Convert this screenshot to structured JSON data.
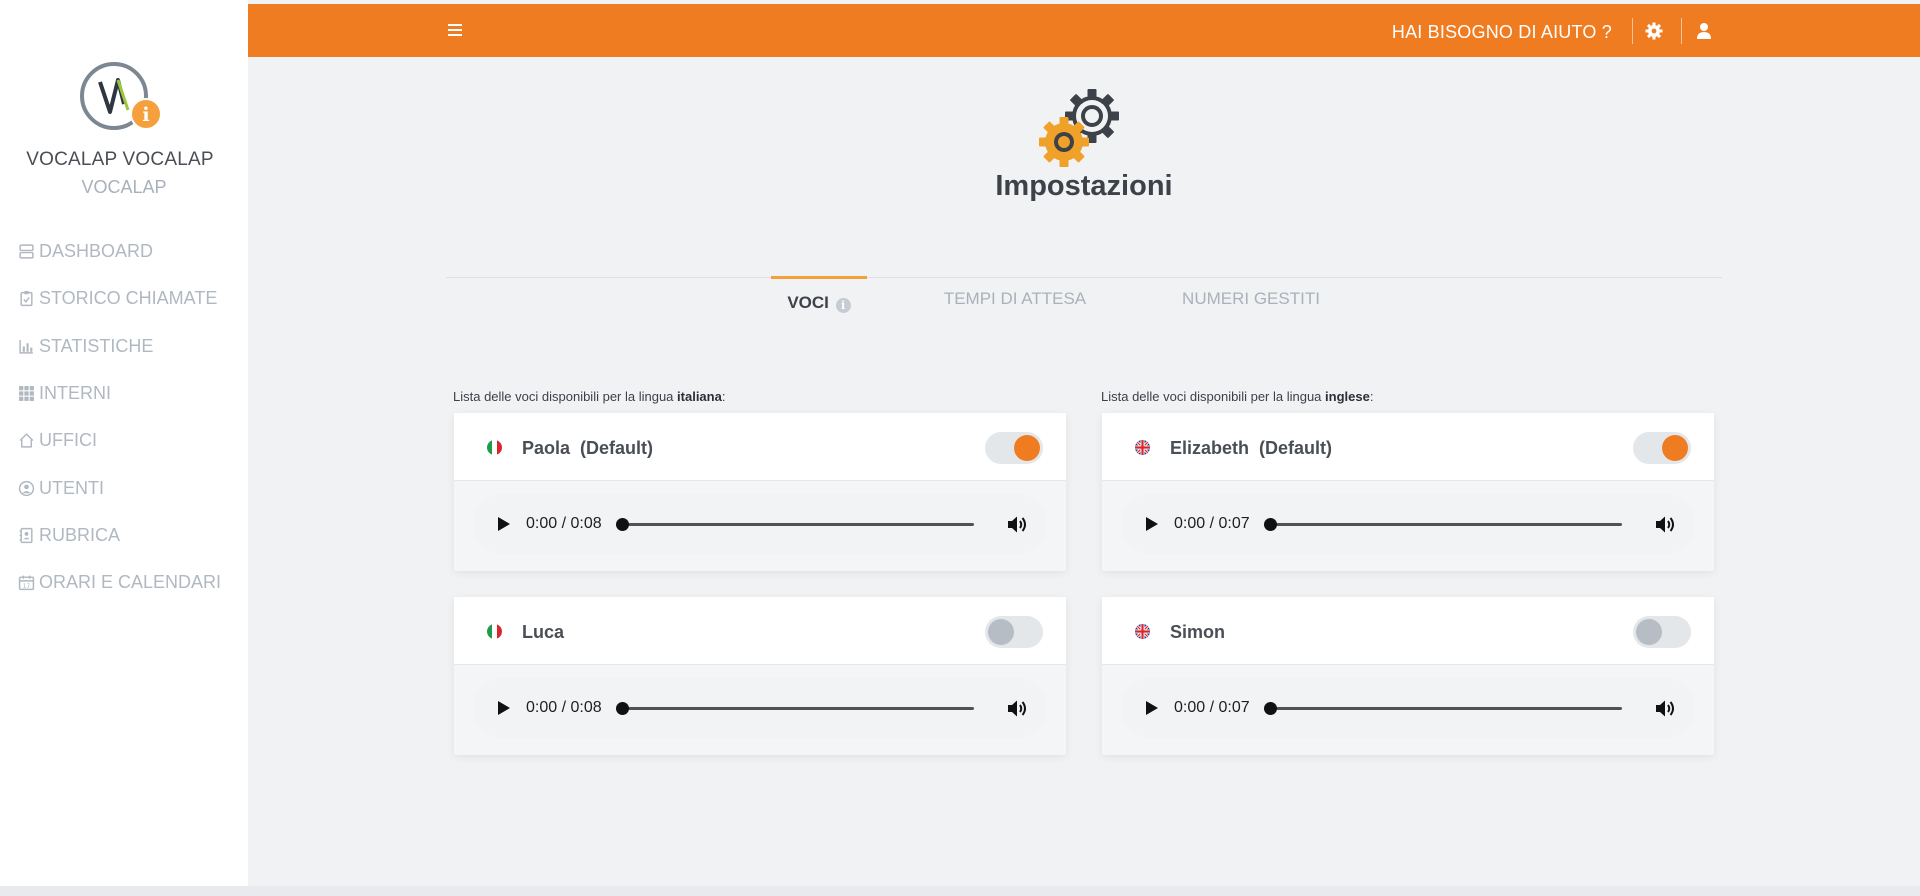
{
  "sidebar": {
    "logo_icon": "vocalap-logo-icon",
    "profile_name": "VOCALAP VOCALAP",
    "profile_sub": "VOCALAP",
    "items": [
      {
        "label": "DASHBOARD",
        "icon": "dashboard-icon"
      },
      {
        "label": "STORICO CHIAMATE",
        "icon": "clipboard-icon"
      },
      {
        "label": "STATISTICHE",
        "icon": "bar-chart-icon"
      },
      {
        "label": "INTERNI",
        "icon": "grid-icon"
      },
      {
        "label": "UFFICI",
        "icon": "home-icon"
      },
      {
        "label": "UTENTI",
        "icon": "user-circle-icon"
      },
      {
        "label": "RUBRICA",
        "icon": "address-book-icon"
      },
      {
        "label": "ORARI E CALENDARI",
        "icon": "calendar-icon"
      }
    ]
  },
  "topbar": {
    "help_label": "HAI BISOGNO DI AIUTO ?",
    "color": "#f07c22"
  },
  "page": {
    "title": "Impostazioni",
    "icon": "gears-icon"
  },
  "tabs": [
    {
      "label": "VOCI",
      "active": true,
      "has_info": true
    },
    {
      "label": "TEMPI DI ATTESA",
      "active": false
    },
    {
      "label": "NUMERI GESTITI",
      "active": false
    }
  ],
  "italian": {
    "label_prefix": "Lista delle voci disponibili per la lingua ",
    "language": "italiana",
    "label_suffix": ":",
    "voices": [
      {
        "name": "Paola  (Default)",
        "enabled": true,
        "time": "0:00 / 0:08"
      },
      {
        "name": "Luca",
        "enabled": false,
        "time": "0:00 / 0:08"
      }
    ]
  },
  "english": {
    "label_prefix": "Lista delle voci disponibili per la lingua ",
    "language": "inglese",
    "label_suffix": ":",
    "voices": [
      {
        "name": "Elizabeth  (Default)",
        "enabled": true,
        "time": "0:00 / 0:07"
      },
      {
        "name": "Simon",
        "enabled": false,
        "time": "0:00 / 0:07"
      }
    ]
  },
  "colors": {
    "accent": "#f07c22",
    "tab_indicator": "#f5a03c",
    "muted_text": "#b0b8c1"
  }
}
